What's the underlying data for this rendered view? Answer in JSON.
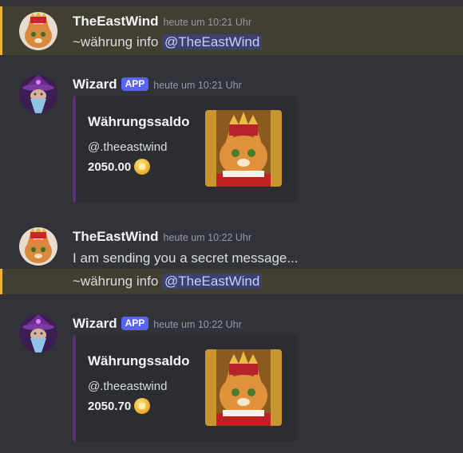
{
  "messages": [
    {
      "author": "TheEastWind",
      "timestamp": "heute um 10:21 Uhr",
      "text": "~währung info ",
      "mention": "@TheEastWind"
    },
    {
      "author": "Wizard",
      "app_tag": "APP",
      "timestamp": "heute um 10:21 Uhr",
      "embed": {
        "title": "Währungssaldo",
        "user": "@.theeastwind",
        "amount": "2050.00"
      }
    },
    {
      "author": "TheEastWind",
      "timestamp": "heute um 10:22 Uhr",
      "text": "I am sending you a secret message...",
      "followup_text": "~währung info ",
      "followup_mention": "@TheEastWind"
    },
    {
      "author": "Wizard",
      "app_tag": "APP",
      "timestamp": "heute um 10:22 Uhr",
      "embed": {
        "title": "Währungssaldo",
        "user": "@.theeastwind",
        "amount": "2050.70"
      }
    }
  ],
  "colors": {
    "background": "#313338",
    "highlight": "#413f32",
    "highlight_bar": "#f0b232",
    "app_tag": "#5865f2",
    "embed_border": "#5e3079"
  },
  "icons": {
    "coin": "coin-icon"
  }
}
